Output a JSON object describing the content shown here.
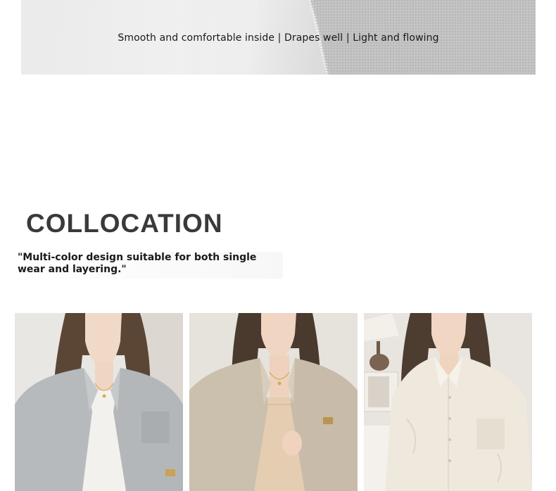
{
  "fabric_banner": {
    "caption": "Smooth and comfortable inside | Drapes well | Light and flowing"
  },
  "collocation": {
    "title": "COLLOCATION",
    "description": "\"Multi-color design suitable for both single wear and layering.\""
  },
  "photos": [
    {
      "name": "grey-blue-shirt-photo",
      "shirt_color": "#b9bcbf"
    },
    {
      "name": "khaki-shirt-photo",
      "shirt_color": "#cfc4b3"
    },
    {
      "name": "white-shirt-photo",
      "shirt_color": "#efe9dd"
    }
  ]
}
